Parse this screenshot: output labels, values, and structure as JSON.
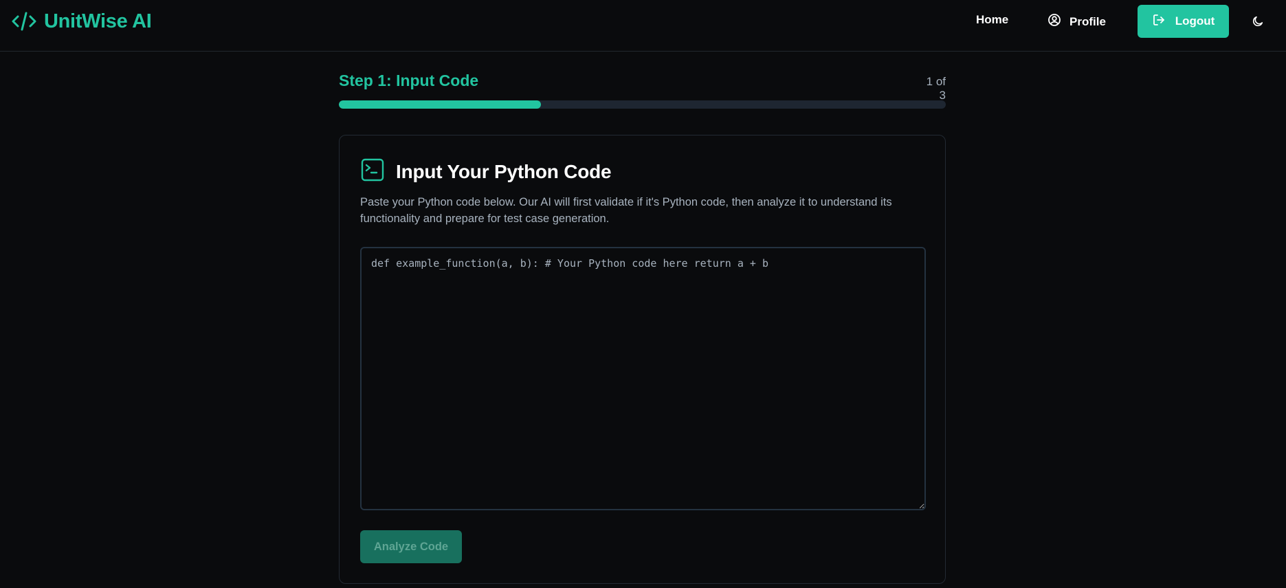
{
  "brand": {
    "name": "UnitWise AI",
    "icon": "code-icon"
  },
  "nav": {
    "home_label": "Home",
    "profile_label": "Profile",
    "profile_icon": "user-circle-icon",
    "logout_label": "Logout",
    "logout_icon": "logout-icon",
    "theme_icon": "moon-icon"
  },
  "step": {
    "title": "Step 1: Input Code",
    "count": "1 of 3",
    "progress_fraction": 0.333
  },
  "card": {
    "icon": "terminal-icon",
    "title": "Input Your Python Code",
    "description": "Paste your Python code below. Our AI will first validate if it's Python code, then analyze it to understand its functionality and prepare for test case generation.",
    "code_placeholder": "def example_function(a, b): # Your Python code here return a + b",
    "code_value": "",
    "analyze_label": "Analyze Code"
  },
  "colors": {
    "accent": "#22c4a0",
    "background": "#0a0b0d",
    "muted_text": "#a8b3bf",
    "disabled_button": "#18705e"
  }
}
